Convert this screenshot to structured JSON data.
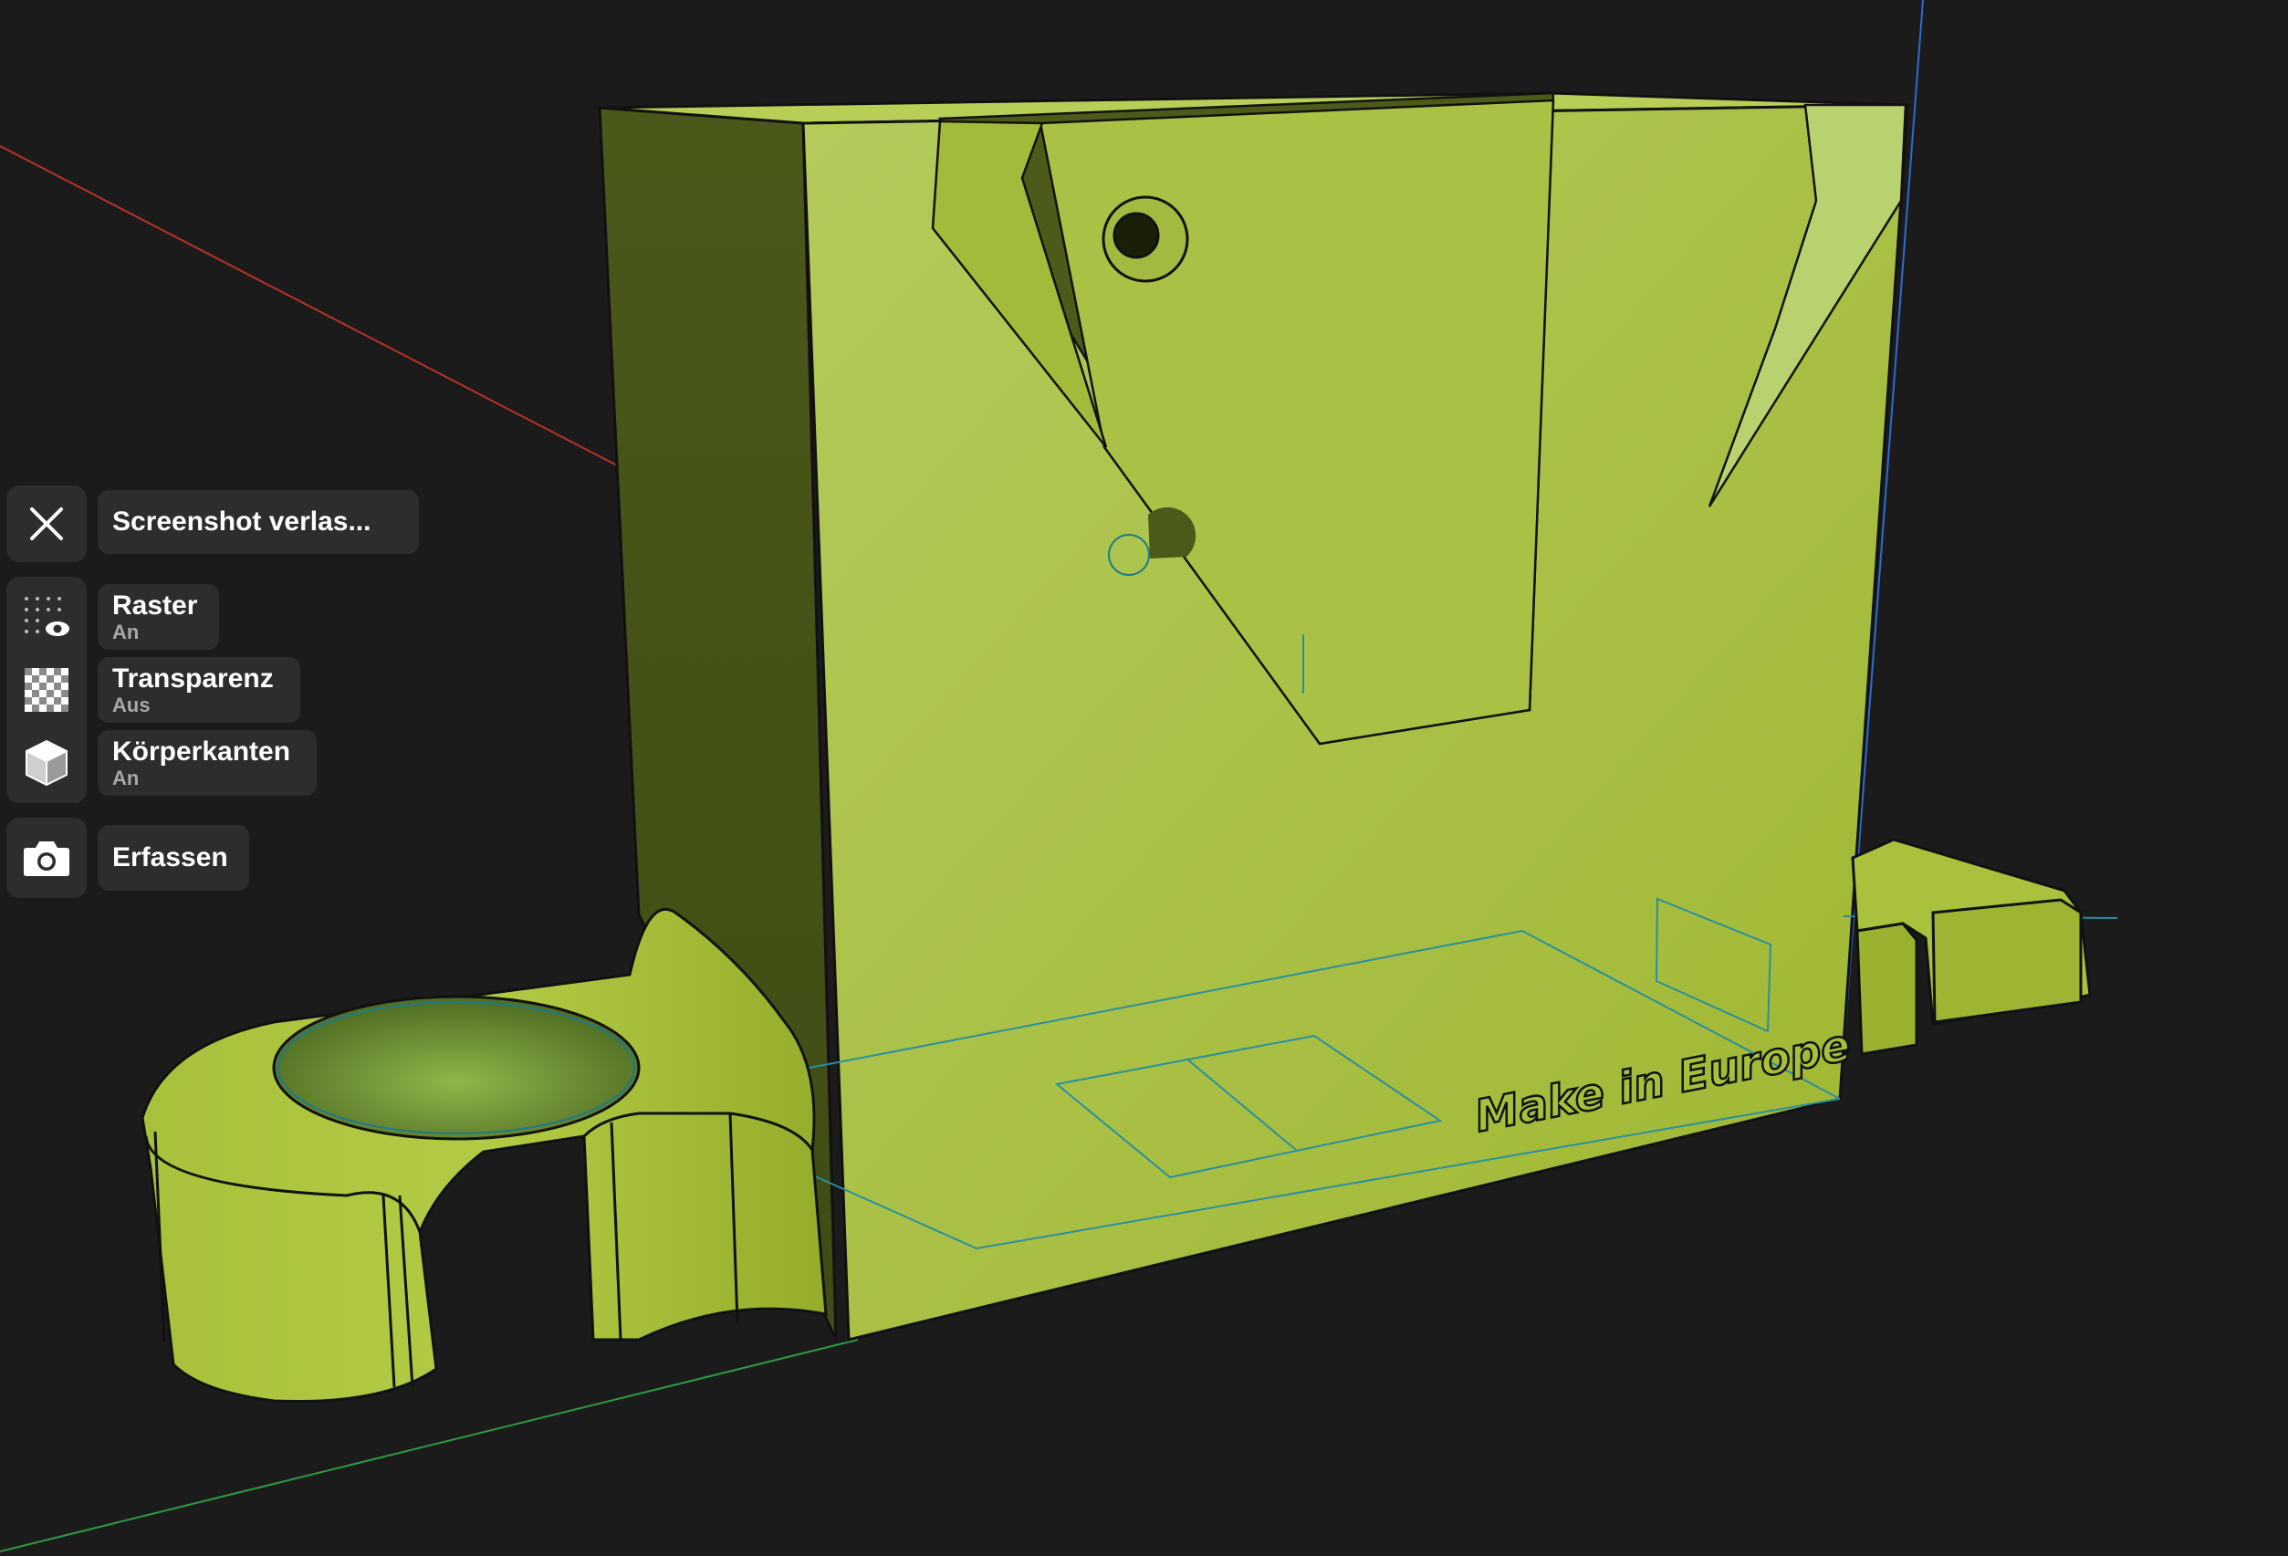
{
  "toolbar": {
    "close_label": "Screenshot verlas...",
    "options": [
      {
        "label": "Raster",
        "state": "An",
        "icon": "grid-visibility-icon"
      },
      {
        "label": "Transparenz",
        "state": "Aus",
        "icon": "checkerboard-icon"
      },
      {
        "label": "Körperkanten",
        "state": "An",
        "icon": "cube-icon"
      }
    ],
    "capture_label": "Erfassen"
  },
  "model": {
    "engraved_text": "Make in Europe",
    "body_color": "#a8c13c",
    "edge_color": "#111111"
  },
  "colors": {
    "background": "#1b1b1b",
    "panel": "#2d2d2d",
    "axis_x": "#c0392b",
    "axis_y": "#27ae60",
    "axis_z": "#2d6ccf"
  }
}
